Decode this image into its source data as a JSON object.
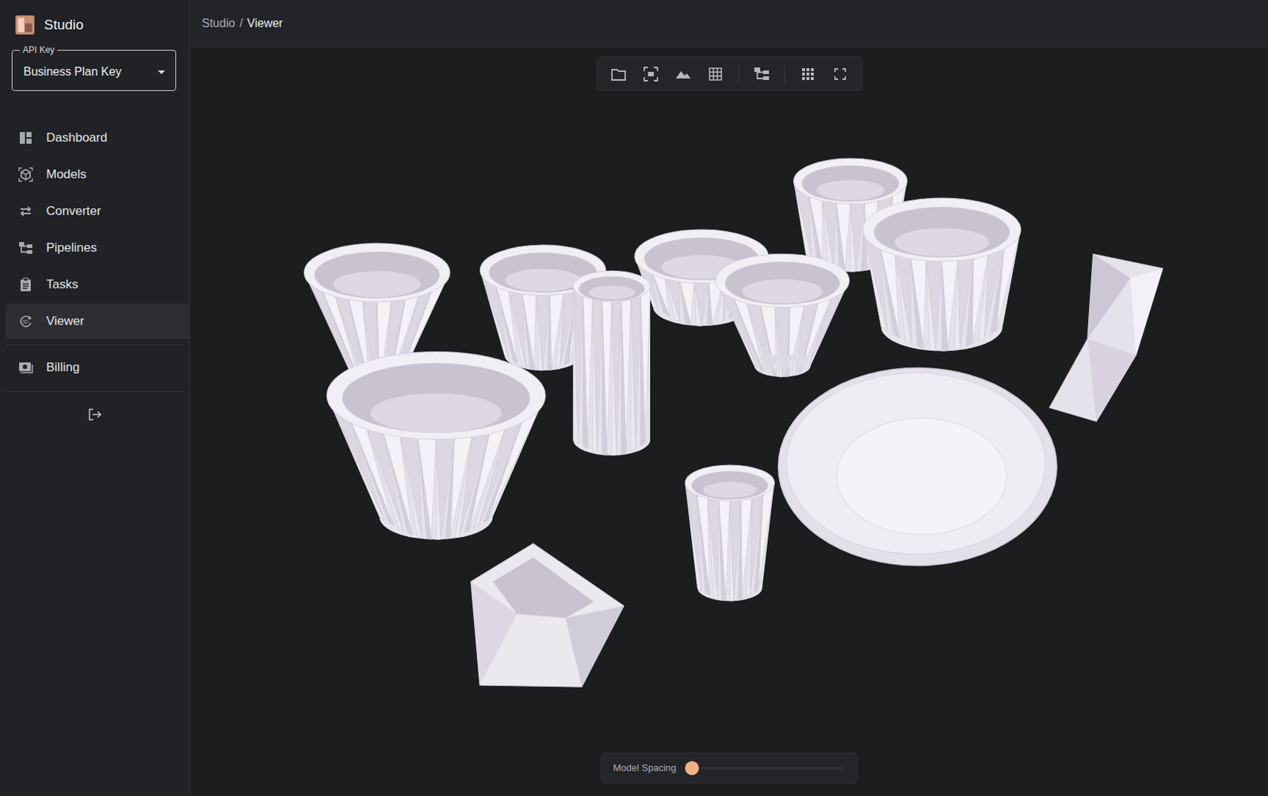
{
  "app": {
    "title": "Studio"
  },
  "api_key": {
    "label": "API Key",
    "value": "Business Plan Key"
  },
  "sidebar": {
    "items": [
      {
        "label": "Dashboard",
        "selected": false
      },
      {
        "label": "Models",
        "selected": false
      },
      {
        "label": "Converter",
        "selected": false
      },
      {
        "label": "Pipelines",
        "selected": false
      },
      {
        "label": "Tasks",
        "selected": false
      },
      {
        "label": "Viewer",
        "selected": true
      }
    ],
    "footer_items": [
      {
        "label": "Billing",
        "selected": false
      }
    ]
  },
  "breadcrumb": {
    "items": [
      "Studio",
      "Viewer"
    ],
    "separator": "/"
  },
  "slider": {
    "label": "Model Spacing",
    "level": 0
  }
}
